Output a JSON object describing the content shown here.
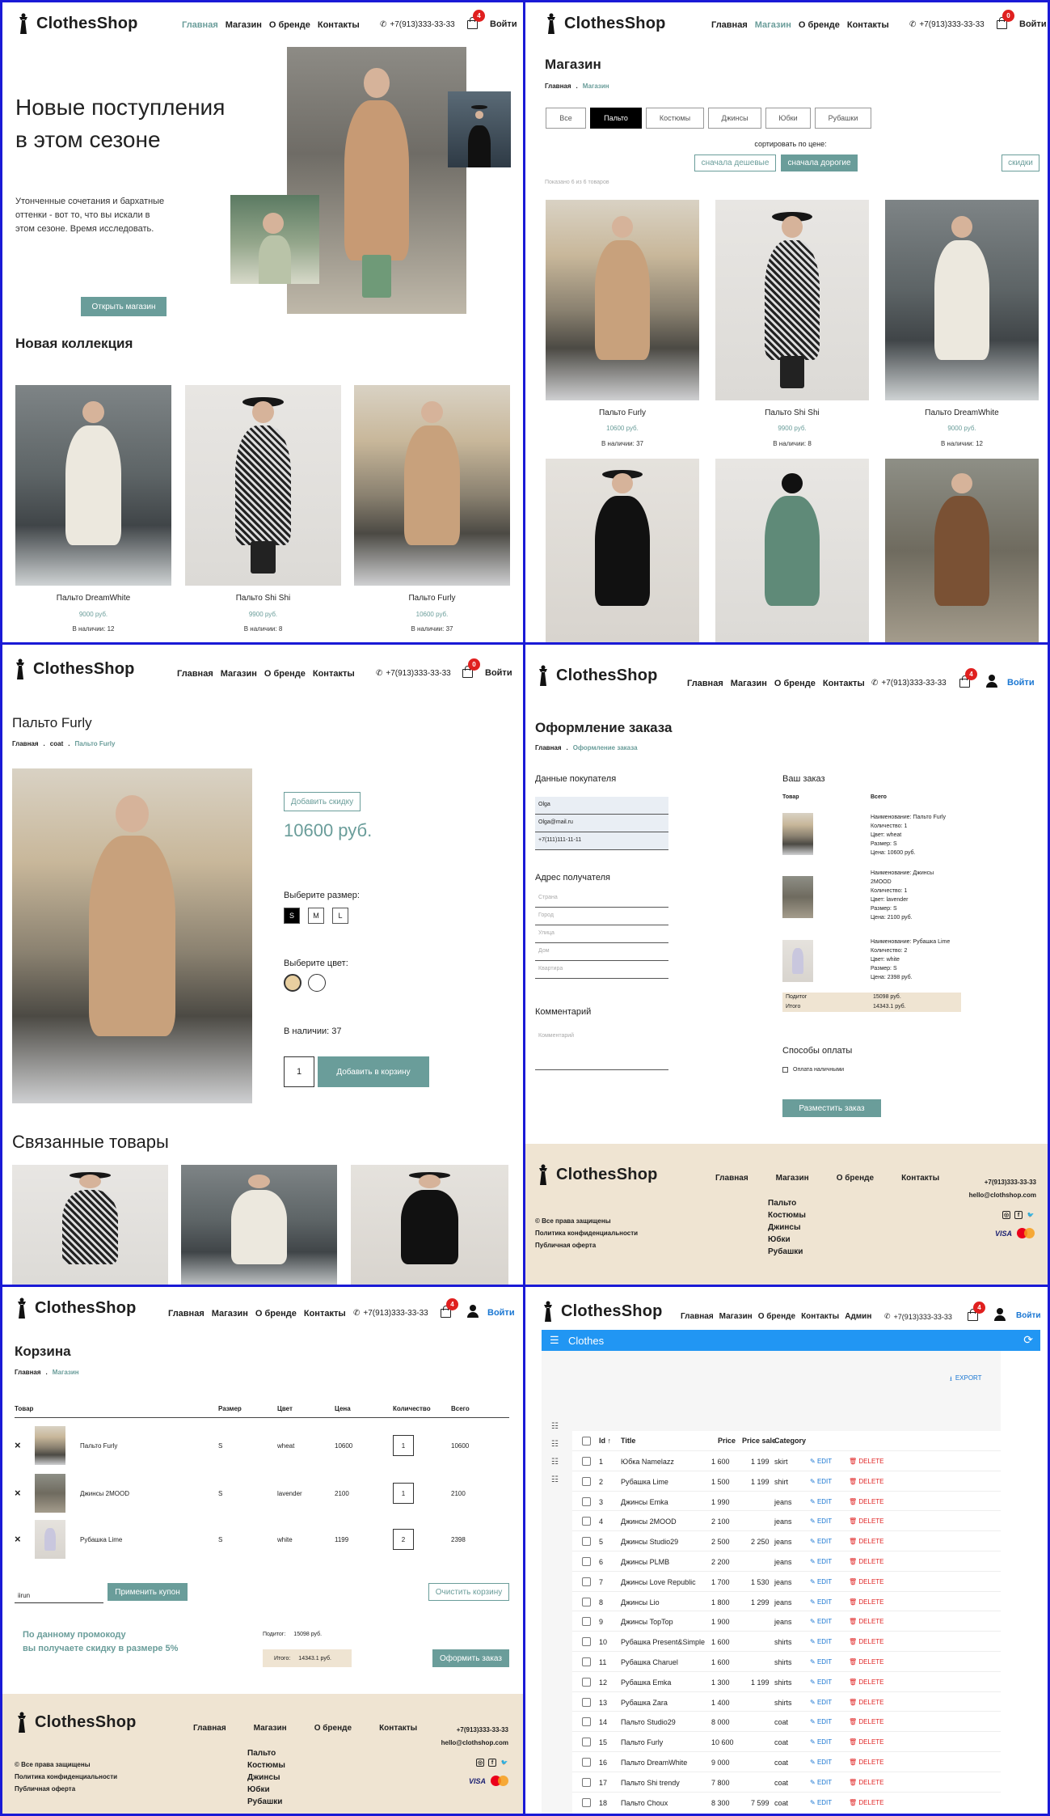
{
  "brand": {
    "name": "ClothesShop",
    "phone": "+7(913)333-33-33",
    "email": "hello@clothshop.com"
  },
  "nav": {
    "home": "Главная",
    "shop": "Магазин",
    "about": "О бренде",
    "contacts": "Контакты",
    "admin": "Админ",
    "login": "Войти"
  },
  "home": {
    "cart_count": "4",
    "hero_title_1": "Новые поступления",
    "hero_title_2": "в этом сезоне",
    "hero_text": "Утонченные сочетания и бархатные оттенки - вот то, что вы искали в этом сезоне. Время исследовать.",
    "hero_button": "Открыть магазин",
    "collection_title": "Новая коллекция",
    "products": [
      {
        "name": "Пальто DreamWhite",
        "price": "9000 руб.",
        "stock": "В наличии: 12"
      },
      {
        "name": "Пальто Shi Shi",
        "price": "9900 руб.",
        "stock": "В наличии: 8"
      },
      {
        "name": "Пальто Furly",
        "price": "10600 руб.",
        "stock": "В наличии: 37"
      }
    ]
  },
  "shop": {
    "cart_count": "0",
    "title": "Магазин",
    "crumb_home": "Главная",
    "crumb_current": "Магазин",
    "tabs": [
      "Все",
      "Пальто",
      "Костюмы",
      "Джинсы",
      "Юбки",
      "Рубашки"
    ],
    "sort_label": "сортировать по цене:",
    "sort_cheap": "сначала дешевые",
    "sort_expensive": "сначала дорогие",
    "discounts": "скидки",
    "shown": "Показано 6 из 6 товаров",
    "products": [
      {
        "name": "Пальто Furly",
        "price": "10600 руб.",
        "stock": "В наличии: 37"
      },
      {
        "name": "Пальто Shi Shi",
        "price": "9900 руб.",
        "stock": "В наличии: 8"
      },
      {
        "name": "Пальто DreamWhite",
        "price": "9000 руб.",
        "stock": "В наличии: 12"
      }
    ]
  },
  "product": {
    "cart_count": "0",
    "title": "Пальто Furly",
    "crumb_home": "Главная",
    "crumb_mid": "coat",
    "crumb_current": "Пальто Furly",
    "add_discount": "Добавить скидку",
    "price": "10600 руб.",
    "size_label": "Выберите размер:",
    "sizes": [
      "S",
      "M",
      "L"
    ],
    "color_label": "Выберите цвет:",
    "stock": "В наличии: 37",
    "qty": "1",
    "add_to_cart": "Добавить в корзину",
    "related_title": "Связанные товары",
    "colors": {
      "wheat": "#e8cfa0",
      "white": "#ffffff"
    }
  },
  "checkout": {
    "cart_count": "4",
    "title": "Оформление заказа",
    "crumb_home": "Главная",
    "crumb_current": "Оформление заказа",
    "buyer_title": "Данные покупателя",
    "buyer_name": "Olga",
    "buyer_email": "Olga@mail.ru",
    "buyer_phone": "+7(111)111-11-11",
    "address_title": "Адрес получателя",
    "address_fields": [
      "Страна",
      "Город",
      "Улица",
      "Дом",
      "Квартира"
    ],
    "comment_title": "Комментарий",
    "comment_placeholder": "Комментарий",
    "order_title": "Ваш заказ",
    "col_product": "Товар",
    "col_total": "Всего",
    "items": [
      {
        "lines": [
          "Наименование: Пальто Furly",
          "Количество: 1",
          "Цвет: wheat",
          "Размер: S",
          "Цена: 10600 руб."
        ]
      },
      {
        "lines": [
          "Наименование: Джинсы 2MOOD",
          "Количество: 1",
          "Цвет: lavender",
          "Размер: S",
          "Цена: 2100 руб."
        ]
      },
      {
        "lines": [
          "Наименование: Рубашка Lime",
          "Количество: 2",
          "Цвет: white",
          "Размер: S",
          "Цена: 2398 руб."
        ]
      }
    ],
    "subtotal_label": "Подитог",
    "subtotal_value": "15098 руб.",
    "total_label": "Итого",
    "total_value": "14343.1 руб.",
    "payment_title": "Способы оплаты",
    "payment_cash": "Оплата наличными",
    "place_order": "Разместить заказ"
  },
  "footer": {
    "rights": "© Все права защищены",
    "privacy": "Политика конфиденциальности",
    "offer": "Публичная оферта",
    "cats": [
      "Пальто",
      "Костюмы",
      "Джинсы",
      "Юбки",
      "Рубашки"
    ]
  },
  "cart_page": {
    "cart_count": "4",
    "title": "Корзина",
    "crumb_home": "Главная",
    "crumb_current": "Магазин",
    "headers": [
      "Товар",
      "Размер",
      "Цвет",
      "Цена",
      "Количество",
      "Всего"
    ],
    "rows": [
      {
        "name": "Пальто Furly",
        "size": "S",
        "color": "wheat",
        "price": "10600",
        "qty": "1",
        "total": "10600"
      },
      {
        "name": "Джинсы 2MOOD",
        "size": "S",
        "color": "lavender",
        "price": "2100",
        "qty": "1",
        "total": "2100"
      },
      {
        "name": "Рубашка Lime",
        "size": "S",
        "color": "white",
        "price": "1199",
        "qty": "2",
        "total": "2398"
      }
    ],
    "coupon_value": "iirun",
    "apply_coupon": "Применить купон",
    "clear_cart": "Очистить корзину",
    "promo_line1": "По данному промокоду",
    "promo_line2": "вы получаете скидку в размере 5%",
    "subtotal_label": "Подитог:",
    "subtotal_value": "15098 руб.",
    "total_label": "Итого:",
    "total_value": "14343.1 руб.",
    "checkout": "Оформить заказ"
  },
  "admin": {
    "cart_count": "4",
    "bar_title": "Clothes",
    "export": "EXPORT",
    "headers": [
      "Id",
      "Title",
      "Price",
      "Price sale",
      "Category"
    ],
    "edit": "EDIT",
    "delete": "DELETE",
    "rows": [
      {
        "id": "1",
        "title": "Юбка Namelazz",
        "price": "1 600",
        "sale": "1 199",
        "cat": "skirt"
      },
      {
        "id": "2",
        "title": "Рубашка Lime",
        "price": "1 500",
        "sale": "1 199",
        "cat": "shirt"
      },
      {
        "id": "3",
        "title": "Джинсы Emka",
        "price": "1 990",
        "sale": "",
        "cat": "jeans"
      },
      {
        "id": "4",
        "title": "Джинсы 2MOOD",
        "price": "2 100",
        "sale": "",
        "cat": "jeans"
      },
      {
        "id": "5",
        "title": "Джинсы Studio29",
        "price": "2 500",
        "sale": "2 250",
        "cat": "jeans"
      },
      {
        "id": "6",
        "title": "Джинсы PLMB",
        "price": "2 200",
        "sale": "",
        "cat": "jeans"
      },
      {
        "id": "7",
        "title": "Джинсы Love Republic",
        "price": "1 700",
        "sale": "1 530",
        "cat": "jeans"
      },
      {
        "id": "8",
        "title": "Джинсы Lio",
        "price": "1 800",
        "sale": "1 299",
        "cat": "jeans"
      },
      {
        "id": "9",
        "title": "Джинсы TopTop",
        "price": "1 900",
        "sale": "",
        "cat": "jeans"
      },
      {
        "id": "10",
        "title": "Рубашка Present&Simple",
        "price": "1 600",
        "sale": "",
        "cat": "shirts"
      },
      {
        "id": "11",
        "title": "Рубашка Charuel",
        "price": "1 600",
        "sale": "",
        "cat": "shirts"
      },
      {
        "id": "12",
        "title": "Рубашка Emka",
        "price": "1 300",
        "sale": "1 199",
        "cat": "shirts"
      },
      {
        "id": "13",
        "title": "Рубашка Zara",
        "price": "1 400",
        "sale": "",
        "cat": "shirts"
      },
      {
        "id": "14",
        "title": "Пальто Studio29",
        "price": "8 000",
        "sale": "",
        "cat": "coat"
      },
      {
        "id": "15",
        "title": "Пальто Furly",
        "price": "10 600",
        "sale": "",
        "cat": "coat"
      },
      {
        "id": "16",
        "title": "Пальто DreamWhite",
        "price": "9 000",
        "sale": "",
        "cat": "coat"
      },
      {
        "id": "17",
        "title": "Пальто Shi trendy",
        "price": "7 800",
        "sale": "",
        "cat": "coat"
      },
      {
        "id": "18",
        "title": "Пальто Choux",
        "price": "8 300",
        "sale": "7 599",
        "cat": "coat"
      }
    ]
  },
  "colors": {
    "accent": "#6a9d9a",
    "footer_bg": "#efe4d2",
    "admin_bar": "#2196f3",
    "badge": "#e0201f"
  }
}
